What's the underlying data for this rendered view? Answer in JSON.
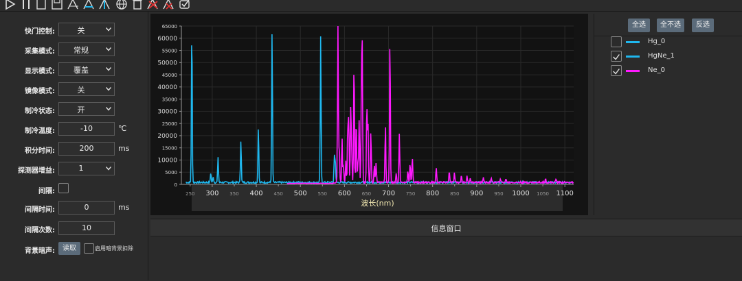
{
  "toolbar": {
    "icons": [
      "play-icon",
      "pause-icon",
      "new-file-icon",
      "save-icon",
      "peak-icon",
      "peak-find-icon",
      "peak-mark-icon",
      "globe-icon",
      "trash-icon",
      "peak-clear-icon",
      "peak-delete-icon",
      "snapshot-icon"
    ]
  },
  "settings": {
    "shutter": {
      "label": "快门控制:",
      "value": "关"
    },
    "acq_mode": {
      "label": "采集模式:",
      "value": "常规"
    },
    "display_mode": {
      "label": "显示模式:",
      "value": "覆盖"
    },
    "mirror_mode": {
      "label": "镜像模式:",
      "value": "关"
    },
    "cool_state": {
      "label": "制冷状态:",
      "value": "开"
    },
    "cool_temp": {
      "label": "制冷温度:",
      "value": "-10",
      "unit": "℃"
    },
    "integ_time": {
      "label": "积分时间:",
      "value": "200",
      "unit": "ms"
    },
    "gain": {
      "label": "探测器增益:",
      "value": "1"
    },
    "interval": {
      "label": "间隔:"
    },
    "interval_time": {
      "label": "间隔时间:",
      "value": "0",
      "unit": "ms"
    },
    "interval_count": {
      "label": "间隔次数:",
      "value": "10"
    },
    "background": {
      "label": "背景暗声:",
      "read_button": "读取",
      "enable_label": "启用暗背景扣除"
    }
  },
  "legend": {
    "select_all": "全选",
    "select_none": "全不选",
    "invert": "反选",
    "items": [
      {
        "name": "Hg_0",
        "checked": false,
        "color": "#1fb7ee"
      },
      {
        "name": "HgNe_1",
        "checked": true,
        "color": "#1fb7ee"
      },
      {
        "name": "Ne_0",
        "checked": true,
        "color": "#ff19ff"
      }
    ]
  },
  "info": {
    "title": "信息窗口"
  },
  "chart_data": {
    "type": "line",
    "xlabel": "波长(nm)",
    "ylabel": "",
    "xlim": [
      230,
      1120
    ],
    "ylim": [
      0,
      65000
    ],
    "x_major_ticks": [
      300,
      400,
      500,
      600,
      700,
      800,
      900,
      1000,
      1100
    ],
    "x_minor_ticks": [
      250,
      350,
      450,
      550,
      650,
      750,
      850,
      950,
      1050
    ],
    "y_ticks": [
      0,
      5000,
      10000,
      15000,
      20000,
      25000,
      30000,
      35000,
      40000,
      45000,
      50000,
      55000,
      60000,
      65000
    ],
    "series": [
      {
        "name": "HgNe_1",
        "color": "#1fb7ee",
        "baseline": 800,
        "peaks": [
          [
            253.7,
            65000
          ],
          [
            296.7,
            4000
          ],
          [
            302.2,
            2500
          ],
          [
            313.2,
            10500
          ],
          [
            365.0,
            17500
          ],
          [
            404.7,
            23000
          ],
          [
            435.8,
            62000
          ],
          [
            546.1,
            60000
          ],
          [
            577.0,
            10500
          ],
          [
            579.1,
            9000
          ]
        ]
      },
      {
        "name": "Ne_0",
        "color": "#ff19ff",
        "baseline": 800,
        "peaks": [
          [
            585.2,
            65000
          ],
          [
            588.2,
            15000
          ],
          [
            594.5,
            19000
          ],
          [
            597.6,
            7000
          ],
          [
            603.0,
            9000
          ],
          [
            607.4,
            22000
          ],
          [
            609.6,
            26000
          ],
          [
            614.3,
            32000
          ],
          [
            616.4,
            12000
          ],
          [
            621.7,
            51000
          ],
          [
            626.6,
            27000
          ],
          [
            630.5,
            8000
          ],
          [
            633.4,
            26000
          ],
          [
            638.3,
            34000
          ],
          [
            640.2,
            57000
          ],
          [
            650.7,
            33000
          ],
          [
            653.3,
            25000
          ],
          [
            659.9,
            21000
          ],
          [
            667.8,
            7000
          ],
          [
            671.7,
            8000
          ],
          [
            692.9,
            24000
          ],
          [
            703.2,
            60000
          ],
          [
            717.4,
            4000
          ],
          [
            724.5,
            20000
          ],
          [
            743.9,
            5000
          ],
          [
            748.9,
            8000
          ],
          [
            753.6,
            5000
          ],
          [
            754.4,
            6000
          ],
          [
            808.2,
            6000
          ],
          [
            837.8,
            5000
          ],
          [
            849.5,
            4000
          ],
          [
            865.4,
            3000
          ],
          [
            878.1,
            2500
          ],
          [
            885.4,
            2000
          ],
          [
            914.9,
            2000
          ],
          [
            932.7,
            1800
          ],
          [
            953.4,
            1600
          ],
          [
            966.5,
            1500
          ],
          [
            1056.2,
            1400
          ],
          [
            1079.8,
            1400
          ]
        ]
      }
    ]
  }
}
